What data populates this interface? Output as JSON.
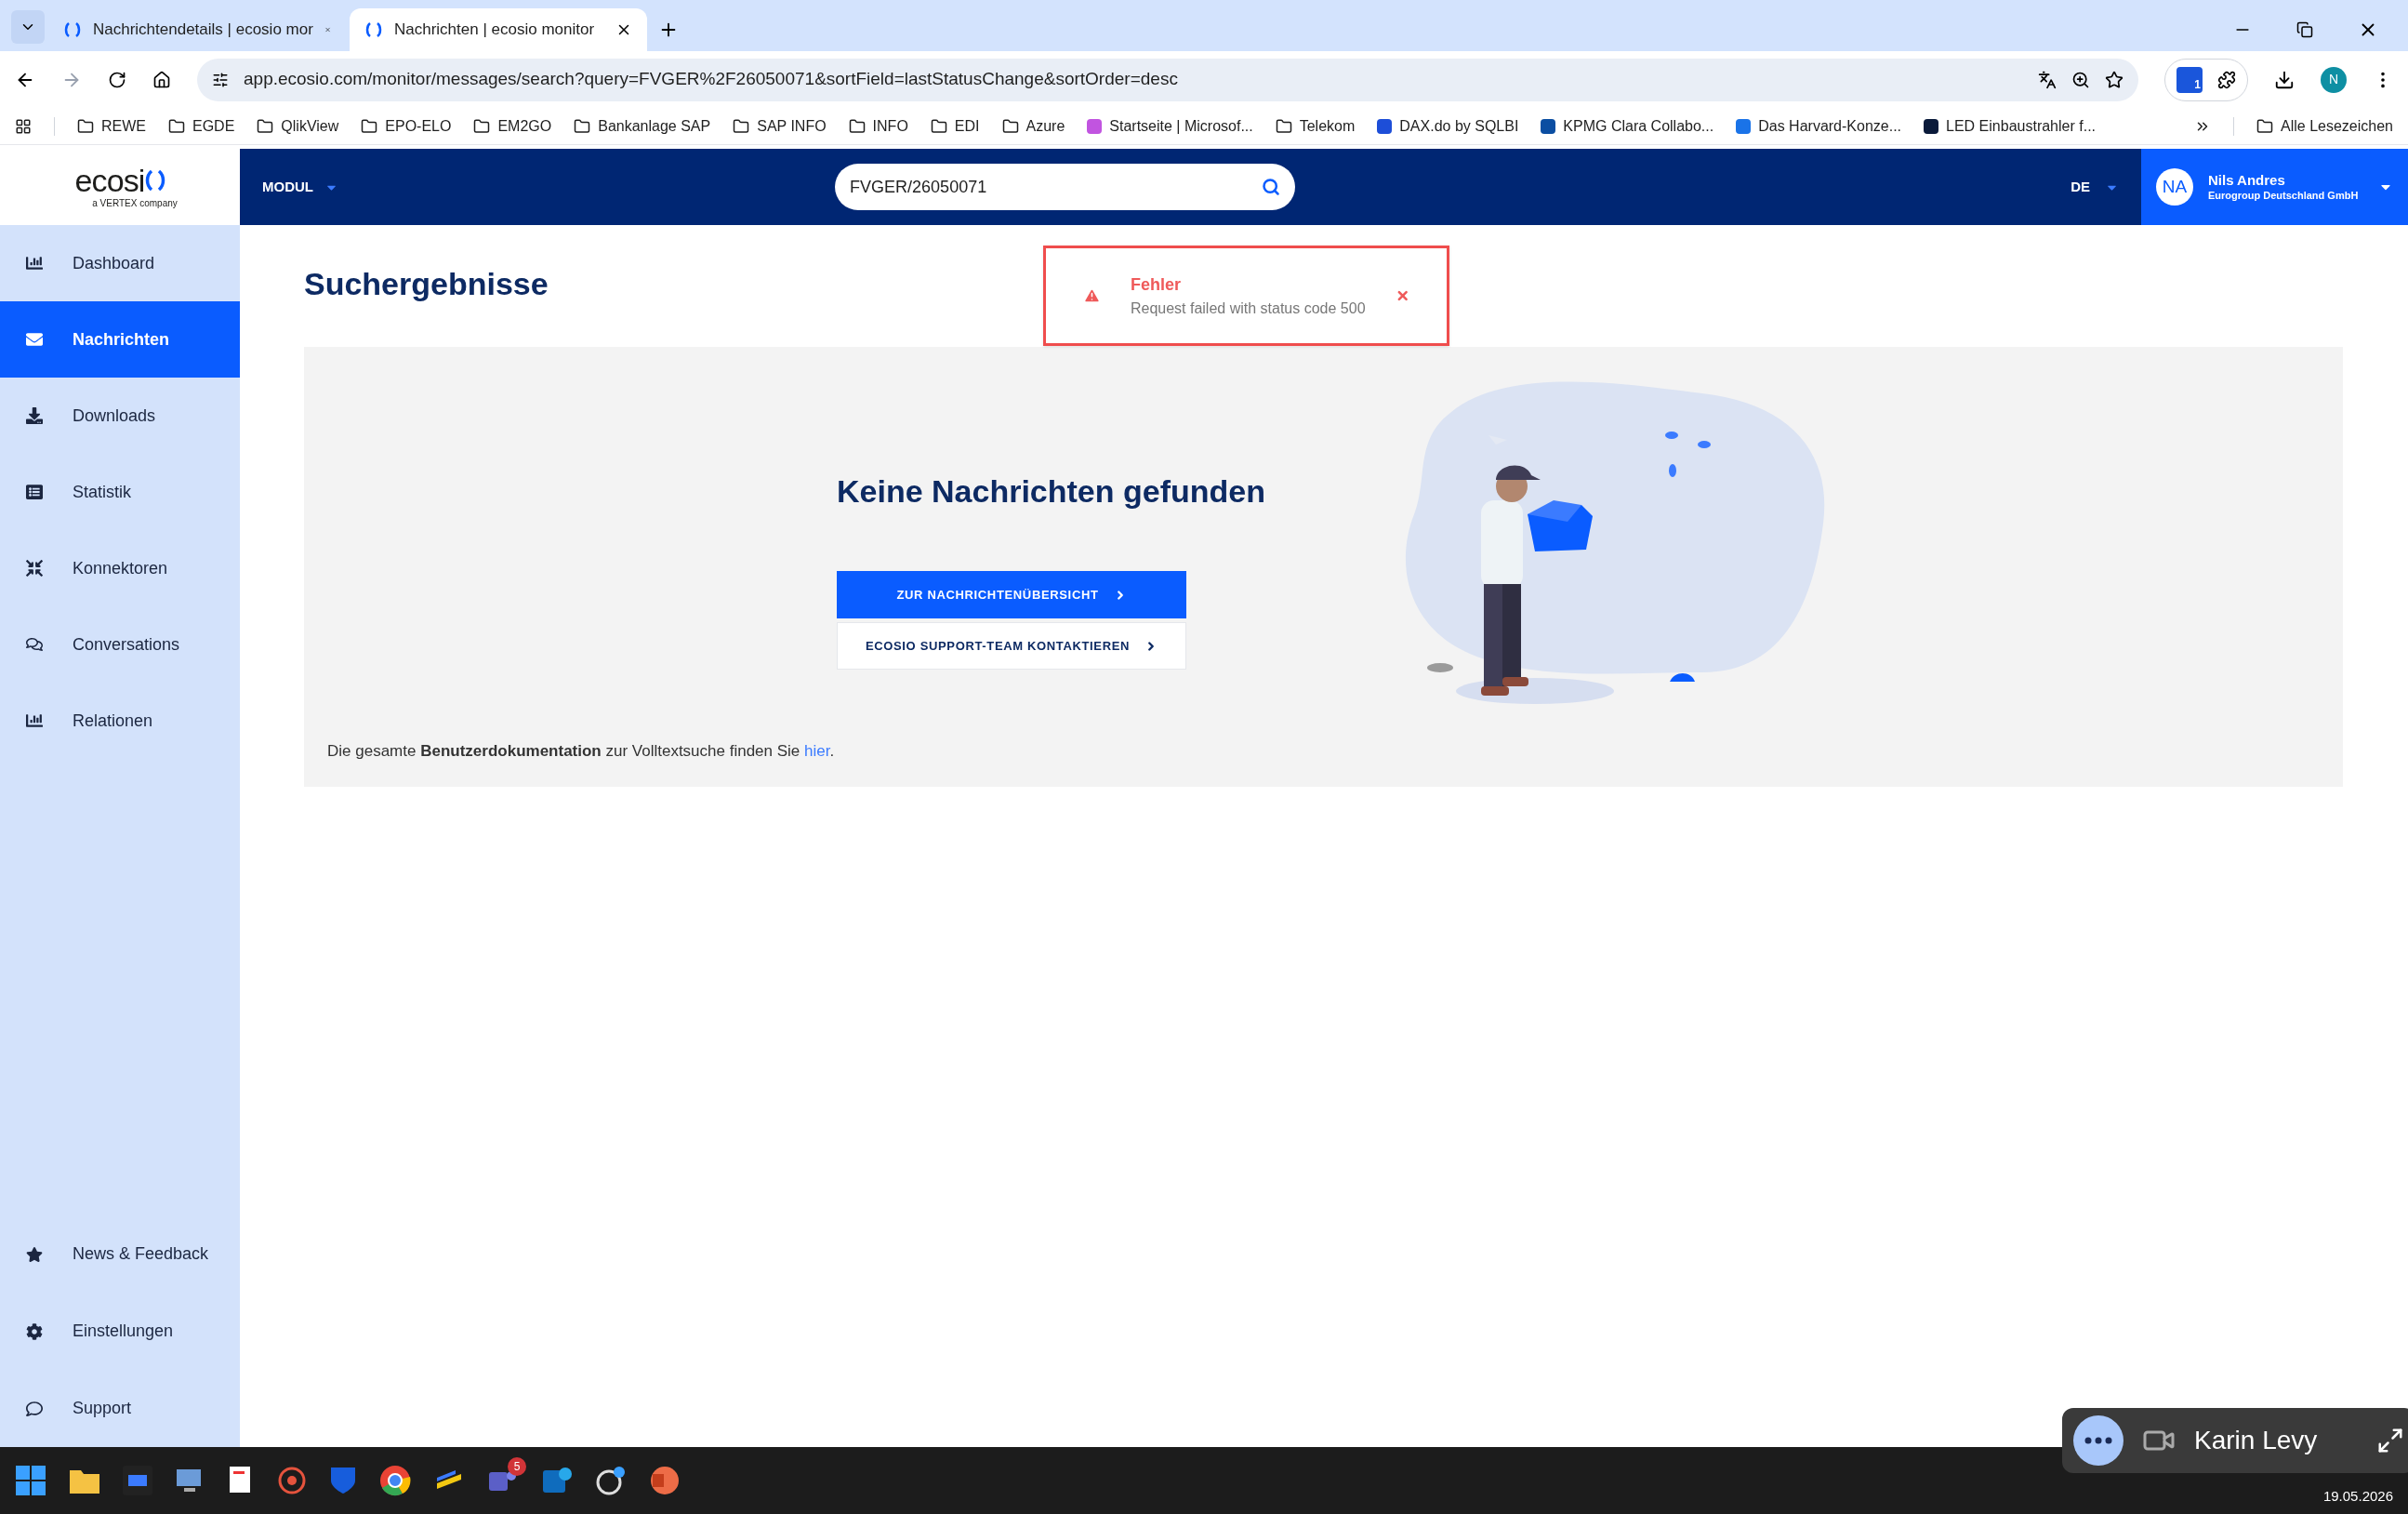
{
  "browser": {
    "tabs": [
      {
        "title": "Nachrichtendetails | ecosio mor",
        "selected": false
      },
      {
        "title": "Nachrichten | ecosio monitor",
        "selected": true
      }
    ],
    "url": "app.ecosio.com/monitor/messages/search?query=FVGER%2F26050071&sortField=lastStatusChange&sortOrder=desc",
    "profile": "N",
    "extension_badge": "1",
    "bookmarks": [
      {
        "kind": "folder",
        "label": "REWE"
      },
      {
        "kind": "folder",
        "label": "EGDE"
      },
      {
        "kind": "folder",
        "label": "QlikView"
      },
      {
        "kind": "folder",
        "label": "EPO-ELO"
      },
      {
        "kind": "folder",
        "label": "EM2GO"
      },
      {
        "kind": "folder",
        "label": "Bankanlage SAP"
      },
      {
        "kind": "folder",
        "label": "SAP INFO"
      },
      {
        "kind": "folder",
        "label": "INFO"
      },
      {
        "kind": "folder",
        "label": "EDI"
      },
      {
        "kind": "folder",
        "label": "Azure"
      },
      {
        "kind": "site",
        "label": "Startseite | Microsof...",
        "color": "#c154e0"
      },
      {
        "kind": "folder",
        "label": "Telekom"
      },
      {
        "kind": "site",
        "label": "DAX.do by SQLBI",
        "color": "#1d4ed8"
      },
      {
        "kind": "site",
        "label": "KPMG Clara Collabo...",
        "color": "#0b4ea2"
      },
      {
        "kind": "site",
        "label": "Das Harvard-Konze...",
        "color": "#1a73e8"
      },
      {
        "kind": "site",
        "label": "LED Einbaustrahler f...",
        "color": "#0a1a3a"
      }
    ],
    "all_bookmarks": "Alle Lesezeichen"
  },
  "app": {
    "logo": "ecosi",
    "tagline": "a VERTEX company",
    "module": "MODUL",
    "search_value": "FVGER/26050071",
    "language": "DE",
    "user": {
      "initials": "NA",
      "name": "Nils Andres",
      "company": "Eurogroup Deutschland GmbH"
    }
  },
  "sidebar": {
    "items": [
      {
        "label": "Dashboard",
        "selected": false
      },
      {
        "label": "Nachrichten",
        "selected": true
      },
      {
        "label": "Downloads",
        "selected": false
      },
      {
        "label": "Statistik",
        "selected": false
      },
      {
        "label": "Konnektoren",
        "selected": false
      },
      {
        "label": "Conversations",
        "selected": false
      },
      {
        "label": "Relationen",
        "selected": false
      }
    ],
    "bottom_items": [
      {
        "label": "News & Feedback"
      },
      {
        "label": "Einstellungen"
      },
      {
        "label": "Support"
      }
    ]
  },
  "page": {
    "title": "Suchergebnisse",
    "toast": {
      "title": "Fehler",
      "message": "Request failed with status code 500"
    },
    "empty_state": {
      "heading": "Keine Nachrichten gefunden",
      "buttons": [
        {
          "kind": "primary",
          "label": "ZUR NACHRICHTENÜBERSICHT"
        },
        {
          "kind": "secondary",
          "label": "ECOSIO SUPPORT-TEAM KONTAKTIEREN"
        }
      ],
      "help_text": "Die gesamte **Benutzerdokumentation** zur Volltextsuche finden Sie",
      "help_link": "hier",
      "help_end": "."
    }
  },
  "call": {
    "name": "Karin Levy"
  },
  "taskbar": {
    "teams_badge": "5",
    "date": "19.05.2026"
  }
}
